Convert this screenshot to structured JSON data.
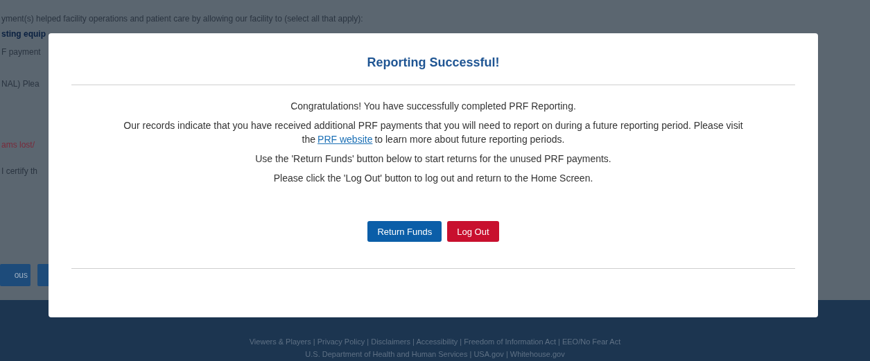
{
  "background": {
    "question": "yment(s) helped facility operations and patient care by allowing our facility to (select all that apply):",
    "snippets": [
      {
        "text": "sting equip",
        "kind": "link"
      },
      {
        "text": "F payment",
        "kind": "plain"
      },
      {
        "text": "NAL) Plea",
        "kind": "plain"
      },
      {
        "text": "ams lost/",
        "kind": "error"
      },
      {
        "text": "I certify th",
        "kind": "plain"
      }
    ],
    "buttons": [
      "ous"
    ]
  },
  "modal": {
    "title": "Reporting Successful!",
    "paragraphs": [
      {
        "text": "Congratulations! You have successfully completed PRF Reporting."
      },
      {
        "text": "Our records indicate that you have received additional PRF payments that you will need to report on during a future reporting period. Please visit the",
        "link": "PRF website",
        "after": "to learn more about future reporting periods."
      },
      {
        "text": "Use the 'Return Funds' button below to start returns for the unused PRF payments."
      },
      {
        "text": "Please click the 'Log Out' button to log out and return to the Home Screen."
      }
    ],
    "buttons": [
      {
        "label": "Return Funds",
        "kind": "primary"
      },
      {
        "label": "Log Out",
        "kind": "danger"
      }
    ]
  },
  "footer": {
    "lines": [
      "Viewers & Players | Privacy Policy | Disclaimers | Accessibility | Freedom of Information Act | EEO/No Fear Act",
      "U.S. Department of Health and Human Services | USA.gov | Whitehouse.gov"
    ]
  }
}
